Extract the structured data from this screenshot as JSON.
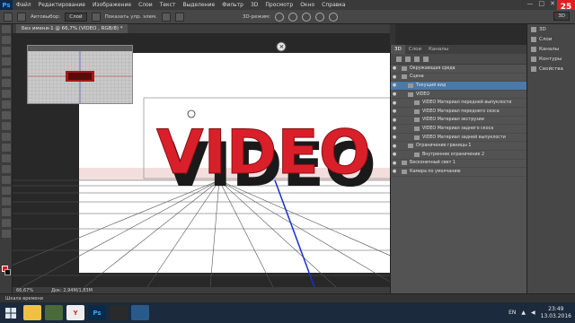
{
  "app": {
    "logo": "Ps"
  },
  "menu": [
    "Файл",
    "Редактирование",
    "Изображение",
    "Слои",
    "Текст",
    "Выделение",
    "Фильтр",
    "3D",
    "Просмотр",
    "Окно",
    "Справка"
  ],
  "window_controls": [
    "—",
    "□",
    "✕"
  ],
  "rec_badge": "25",
  "options": {
    "autoselect_label": "Автовыбор:",
    "autoselect_value": "Слой",
    "show_controls": "Показать упр. элем.",
    "mode_3d": "3D-режим:",
    "workspace": "3D"
  },
  "document_tab": "Без имени-1 @ 66,7% (VIDEO , RGB/8) *",
  "canvas": {
    "text_3d": "VIDEO",
    "text_color": "#d9202a",
    "shadow_color": "#1a1a1a"
  },
  "panels": {
    "tabs": [
      "3D",
      "Слои",
      "Каналы"
    ],
    "layers": [
      {
        "label": "Окружающая среда",
        "depth": 0,
        "selected": false
      },
      {
        "label": "Сцена",
        "depth": 0,
        "selected": false
      },
      {
        "label": "Текущий вид",
        "depth": 1,
        "selected": true
      },
      {
        "label": "VIDEO",
        "depth": 1,
        "selected": false
      },
      {
        "label": "VIDEO  Материал передней выпуклости",
        "depth": 2,
        "selected": false
      },
      {
        "label": "VIDEO  Материал переднего скоса",
        "depth": 2,
        "selected": false
      },
      {
        "label": "VIDEO  Материал экструзии",
        "depth": 2,
        "selected": false
      },
      {
        "label": "VIDEO  Материал заднего скоса",
        "depth": 2,
        "selected": false
      },
      {
        "label": "VIDEO  Материал задней выпуклости",
        "depth": 2,
        "selected": false
      },
      {
        "label": "Ограничение границы 1",
        "depth": 1,
        "selected": false
      },
      {
        "label": "Внутреннее ограничение 2",
        "depth": 2,
        "selected": false
      },
      {
        "label": "Бесконечный свет 1",
        "depth": 0,
        "selected": false
      },
      {
        "label": "Камера по умолчанию",
        "depth": 0,
        "selected": false
      }
    ]
  },
  "right_strip": [
    "3D",
    "Слои",
    "Каналы",
    "Контуры",
    "Свойства"
  ],
  "status": {
    "zoom": "66,67%",
    "doc": "Док: 2,94M/1,83M"
  },
  "timeline": "Шкала времени",
  "taskbar": {
    "lang": "EN",
    "time": "23:49",
    "date": "13.03.2016"
  },
  "colors": {
    "accent": "#4b79a8",
    "foreground": "#e01818",
    "background": "#111111"
  }
}
